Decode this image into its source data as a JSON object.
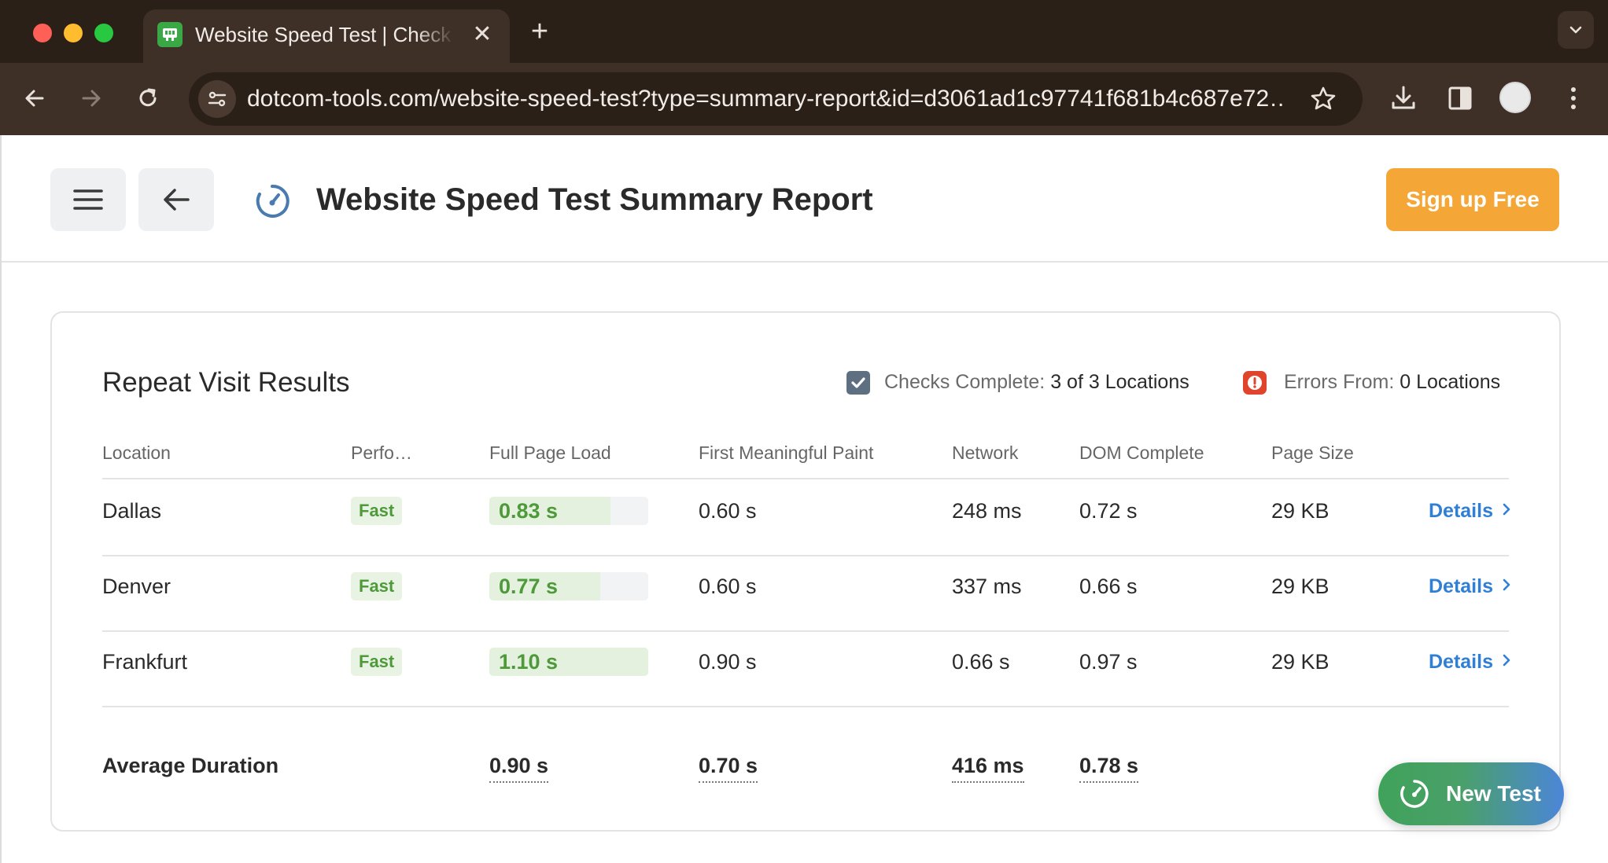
{
  "browser": {
    "tab_title": "Website Speed Test | Check Website Speed",
    "tab_close": "✕",
    "new_tab": "+",
    "url": "dotcom-tools.com/website-speed-test?type=summary-report&id=d3061ad1c97741f681b4c687e72…"
  },
  "header": {
    "title": "Website Speed Test Summary Report",
    "signup_label": "Sign up Free"
  },
  "results": {
    "title": "Repeat Visit Results",
    "checks_label": "Checks Complete:",
    "checks_value": "3 of 3 Locations",
    "errors_label": "Errors From:",
    "errors_value": "0 Locations",
    "columns": [
      "Location",
      "Perfo…",
      "Full Page Load",
      "First Meaningful Paint",
      "Network",
      "DOM Complete",
      "Page Size"
    ],
    "rows": [
      {
        "location": "Dallas",
        "performance": "Fast",
        "full_page_load": "0.83 s",
        "load_fraction": 0.76,
        "fmp": "0.60 s",
        "network": "248 ms",
        "dom_complete": "0.72 s",
        "page_size": "29 KB",
        "details": "Details"
      },
      {
        "location": "Denver",
        "performance": "Fast",
        "full_page_load": "0.77 s",
        "load_fraction": 0.7,
        "fmp": "0.60 s",
        "network": "337 ms",
        "dom_complete": "0.66 s",
        "page_size": "29 KB",
        "details": "Details"
      },
      {
        "location": "Frankfurt",
        "performance": "Fast",
        "full_page_load": "1.10 s",
        "load_fraction": 1.0,
        "fmp": "0.90 s",
        "network": "0.66 s",
        "dom_complete": "0.97 s",
        "page_size": "29 KB",
        "details": "Details"
      }
    ],
    "average": {
      "label": "Average Duration",
      "full_page_load": "0.90 s",
      "fmp": "0.70 s",
      "network": "416 ms",
      "dom_complete": "0.78 s"
    }
  },
  "new_test_label": "New Test",
  "colors": {
    "accent_orange": "#f4a636",
    "fast_green": "#4e9a3a",
    "link_blue": "#2f7fd6"
  }
}
